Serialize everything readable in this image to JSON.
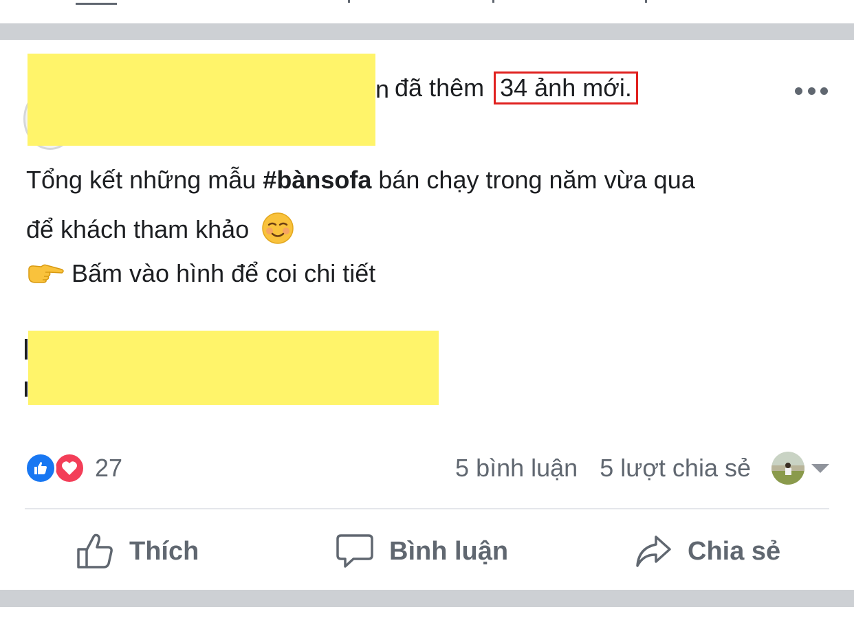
{
  "post": {
    "header_suffix": "đã thêm",
    "header_highlight": "34 ảnh mới.",
    "text_line1_before": "Tổng kết những mẫu ",
    "text_line1_hashtag": "#bànsofa",
    "text_line1_after": " bán chạy trong năm vừa qua",
    "text_line2": "để khách tham khảo",
    "text_line3": "Bấm vào hình để coi chi tiết",
    "emoji_smile": "smiling-face-icon",
    "emoji_point": "pointing-hand-icon"
  },
  "reactions": {
    "types": [
      "like",
      "love"
    ],
    "count": "27"
  },
  "counts": {
    "comments": "5 bình luận",
    "shares": "5 lượt chia sẻ"
  },
  "actions": {
    "like": "Thích",
    "comment": "Bình luận",
    "share": "Chia sẻ"
  },
  "colors": {
    "redaction": "#fff46a",
    "highlight_border": "#e0201e",
    "like_blue": "#1877f2",
    "love_red": "#f33e58",
    "secondary_text": "#606770",
    "separator": "#cdd0d4"
  }
}
